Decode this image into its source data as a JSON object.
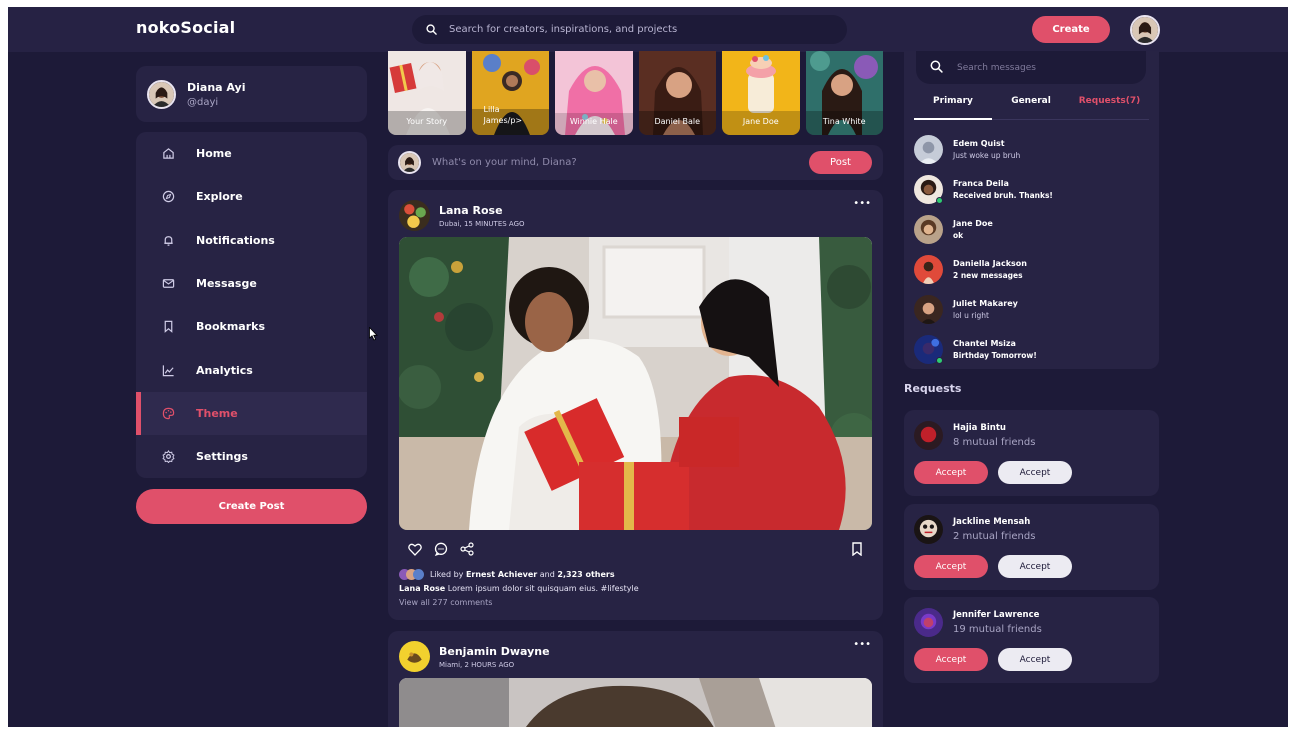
{
  "app": {
    "logo": "nokoSocial"
  },
  "header": {
    "search_placeholder": "Search for creators, inspirations, and projects",
    "create_label": "Create"
  },
  "profile": {
    "name": "Diana Ayi",
    "handle": "@dayi"
  },
  "sidebar": {
    "items": [
      {
        "label": "Home",
        "icon": "home-icon"
      },
      {
        "label": "Explore",
        "icon": "compass-icon"
      },
      {
        "label": "Notifications",
        "icon": "bell-icon"
      },
      {
        "label": "Messasge",
        "icon": "envelope-icon"
      },
      {
        "label": "Bookmarks",
        "icon": "bookmark-icon"
      },
      {
        "label": "Analytics",
        "icon": "chart-line-icon"
      },
      {
        "label": "Theme",
        "icon": "palette-icon",
        "active": true
      },
      {
        "label": "Settings",
        "icon": "gear-icon"
      }
    ],
    "create_post_label": "Create Post"
  },
  "stories": [
    {
      "label": "Your Story"
    },
    {
      "label": "Lilla James/p>"
    },
    {
      "label": "Winnie Hale"
    },
    {
      "label": "Daniel Bale"
    },
    {
      "label": "Jane Doe"
    },
    {
      "label": "Tina White"
    }
  ],
  "composer": {
    "placeholder": "What's on your mind, Diana?",
    "post_label": "Post"
  },
  "posts": [
    {
      "author": "Lana Rose",
      "meta": "Dubai, 15 MINUTES AGO",
      "more": "•••",
      "liked_prefix": "Liked by",
      "liked_user": "Ernest Achiever",
      "liked_and": "and",
      "liked_others": "2,323 others",
      "caption_author": "Lana Rose",
      "caption_text": "Lorem ipsum dolor sit quisquam eius. #lifestyle",
      "view_comments": "View all 277 comments"
    },
    {
      "author": "Benjamin Dwayne",
      "meta": "Miami, 2 HOURS AGO",
      "more": "•••"
    }
  ],
  "messages": {
    "search_placeholder": "Search messages",
    "tabs": [
      "Primary",
      "General",
      "Requests(7)"
    ],
    "items": [
      {
        "name": "Edem Quist",
        "text": "Just woke up bruh"
      },
      {
        "name": "Franca Deila",
        "text": "Received bruh. Thanks!"
      },
      {
        "name": "Jane Doe",
        "text": "ok"
      },
      {
        "name": "Daniella Jackson",
        "text": "2 new messages"
      },
      {
        "name": "Juliet Makarey",
        "text": "lol u right"
      },
      {
        "name": "Chantel Msiza",
        "text": "Birthday Tomorrow!"
      }
    ]
  },
  "requests": {
    "title": "Requests",
    "accept_label": "Accept",
    "decline_label": "Accept",
    "items": [
      {
        "name": "Hajia Bintu",
        "mutual": "8 mutual friends"
      },
      {
        "name": "Jackline Mensah",
        "mutual": "2 mutual friends"
      },
      {
        "name": "Jennifer Lawrence",
        "mutual": "19 mutual friends"
      }
    ]
  },
  "colors": {
    "background": "#1d1a38",
    "card": "#272344",
    "accent": "#e0506a",
    "online": "#2ecc71"
  }
}
